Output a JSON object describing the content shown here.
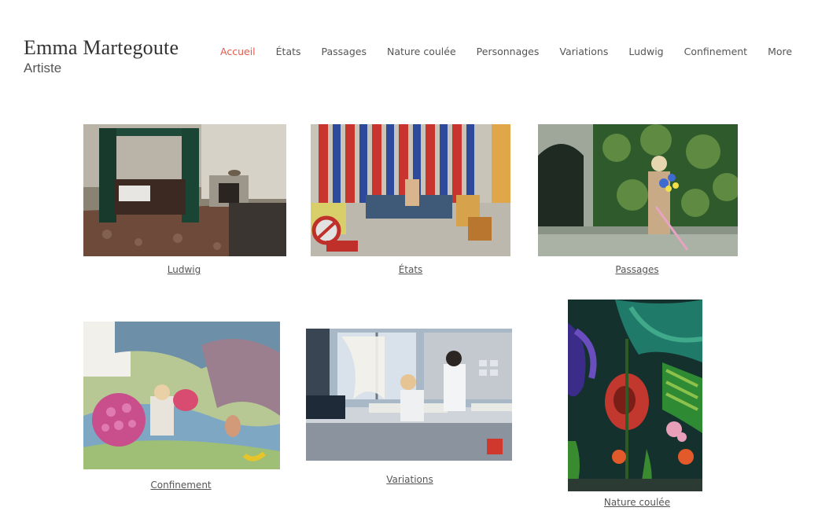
{
  "header": {
    "title": "Emma Martegoute",
    "subtitle": "Artiste"
  },
  "nav": {
    "items": [
      "Accueil",
      "États",
      "Passages",
      "Nature coulée",
      "Personnages",
      "Variations",
      "Ludwig",
      "Confinement",
      "More"
    ],
    "active_index": 0
  },
  "gallery": {
    "items": [
      {
        "caption": "Ludwig"
      },
      {
        "caption": "États"
      },
      {
        "caption": "Passages"
      },
      {
        "caption": "Confinement"
      },
      {
        "caption": "Variations"
      },
      {
        "caption": "Nature coulée"
      }
    ]
  },
  "colors": {
    "accent": "#e6584a",
    "text": "#555555"
  }
}
